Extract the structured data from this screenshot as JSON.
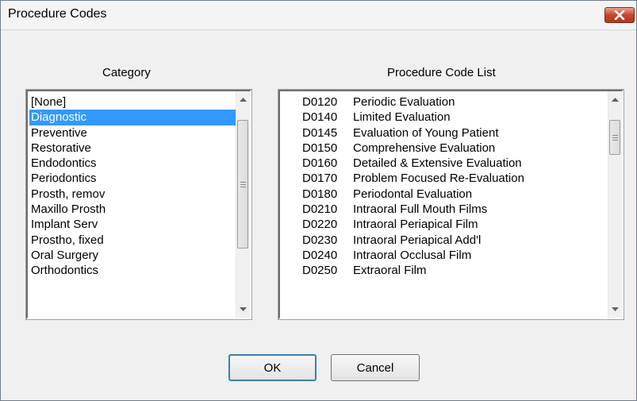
{
  "window": {
    "title": "Procedure Codes"
  },
  "icons": {
    "close": "close-icon",
    "scroll_up": "chevron-up-icon",
    "scroll_down": "chevron-down-icon"
  },
  "colors": {
    "selection": "#3399ff",
    "close_button": "#c7442a"
  },
  "category": {
    "label": "Category",
    "selected_index": 1,
    "items": [
      "[None]",
      "Diagnostic",
      "Preventive",
      "Restorative",
      "Endodontics",
      "Periodontics",
      "Prosth, remov",
      "Maxillo Prosth",
      "Implant Serv",
      "Prostho, fixed",
      "Oral Surgery",
      "Orthodontics"
    ]
  },
  "procedures": {
    "label": "Procedure Code List",
    "rows": [
      {
        "code": "D0120",
        "desc": "Periodic Evaluation"
      },
      {
        "code": "D0140",
        "desc": "Limited Evaluation"
      },
      {
        "code": "D0145",
        "desc": "Evaluation of Young Patient"
      },
      {
        "code": "D0150",
        "desc": "Comprehensive Evaluation"
      },
      {
        "code": "D0160",
        "desc": "Detailed & Extensive Evaluation"
      },
      {
        "code": "D0170",
        "desc": "Problem Focused Re-Evaluation"
      },
      {
        "code": "D0180",
        "desc": "Periodontal Evaluation"
      },
      {
        "code": "D0210",
        "desc": "Intraoral Full Mouth Films"
      },
      {
        "code": "D0220",
        "desc": "Intraoral Periapical Film"
      },
      {
        "code": "D0230",
        "desc": "Intraoral Periapical Add'l"
      },
      {
        "code": "D0240",
        "desc": "Intraoral Occlusal Film"
      },
      {
        "code": "D0250",
        "desc": "Extraoral Film"
      }
    ]
  },
  "buttons": {
    "ok": "OK",
    "cancel": "Cancel"
  }
}
